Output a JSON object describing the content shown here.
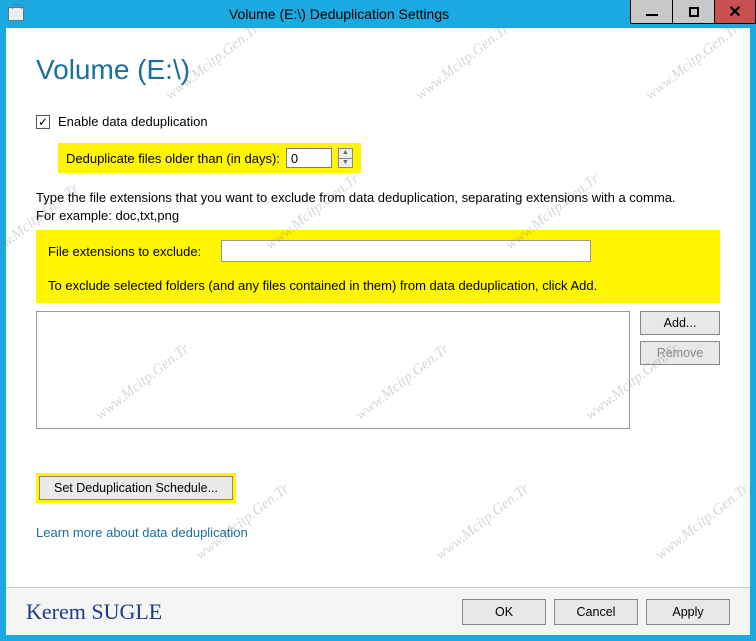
{
  "window": {
    "title": "Volume (E:\\) Deduplication Settings"
  },
  "heading": "Volume (E:\\)",
  "enableCheckbox": {
    "checked": true,
    "label": "Enable data deduplication"
  },
  "olderThan": {
    "label": "Deduplicate files older than (in days):",
    "value": "0"
  },
  "description": "Type the file extensions that you want to exclude from data deduplication, separating extensions with a comma. For example: doc,txt,png",
  "extensions": {
    "label": "File extensions to exclude:",
    "value": ""
  },
  "excludeFoldersNote": "To exclude selected folders (and any files contained in them) from data deduplication, click Add.",
  "buttons": {
    "add": "Add...",
    "remove": "Remove",
    "schedule": "Set Deduplication Schedule...",
    "ok": "OK",
    "cancel": "Cancel",
    "apply": "Apply"
  },
  "link": "Learn more about data deduplication",
  "author": "Kerem SUGLE",
  "watermark": "www.Mcitp.Gen.Tr"
}
